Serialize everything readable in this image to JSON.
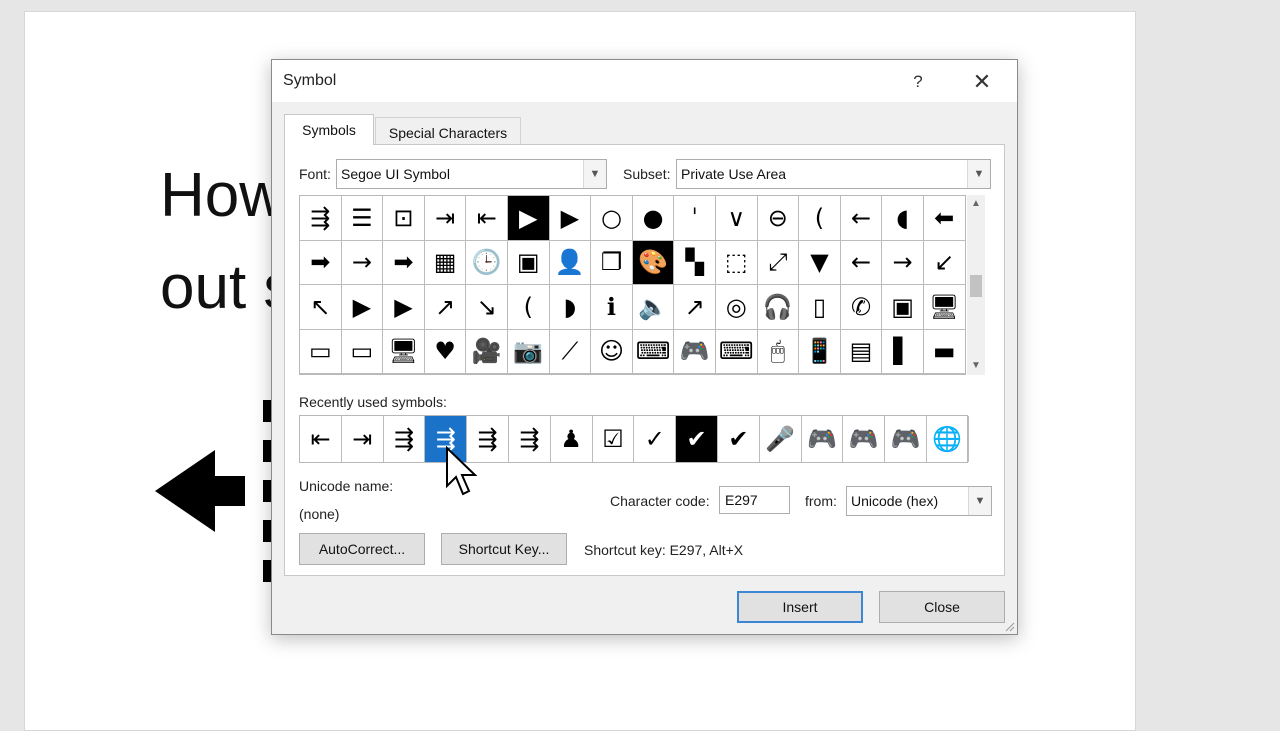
{
  "background_doc": {
    "line1": "How",
    "line2": "out s"
  },
  "dialog": {
    "title": "Symbol",
    "help_label": "?",
    "close_label": "✕",
    "tabs": [
      {
        "label": "Symbols",
        "active": true
      },
      {
        "label": "Special Characters",
        "active": false
      }
    ],
    "font_label": "Font:",
    "font_value": "Segoe UI Symbol",
    "subset_label": "Subset:",
    "subset_value": "Private Use Area",
    "symbol_grid": {
      "rows": [
        [
          "⇶",
          "☰",
          "⊡",
          "⇥",
          "⇤",
          "▶",
          "▶",
          "○",
          "●",
          "ˈ",
          "∨",
          "⊖",
          "(",
          "←",
          "◖",
          "⬅"
        ],
        [
          "➡",
          "→",
          "➡",
          "▦",
          "🕒",
          "▣",
          "👤",
          "❐",
          "🎨",
          "▚",
          "⬚",
          "⤢",
          "▼",
          "←",
          "→",
          "↙"
        ],
        [
          "↖",
          "▶",
          "▶",
          "↗",
          "↘",
          "(",
          "◗",
          "ℹ",
          "🔈",
          "↗",
          "◎",
          "🎧",
          "▯",
          "✆",
          "▣",
          "🖥"
        ],
        [
          "▭",
          "▭",
          "🖥",
          "♥",
          "🎥",
          "📷",
          "⟋",
          "☺",
          "⌨",
          "🎮",
          "⌨",
          "🖱",
          "📱",
          "▤",
          "▌",
          "▬"
        ]
      ],
      "inverted": [
        "0,5",
        "1,8"
      ]
    },
    "recent_label": "Recently used symbols:",
    "recent_symbols": [
      "⇤",
      "⇥",
      "⇶",
      "⇶",
      "⇶",
      "⇶",
      "♟",
      "☑",
      "✓",
      "✔",
      "✔",
      "🎤",
      "🎮",
      "🎮",
      "🎮",
      "🌐"
    ],
    "unicode_name_label": "Unicode name:",
    "unicode_name_value": "(none)",
    "character_code_label": "Character code:",
    "character_code_value": "E297",
    "from_label": "from:",
    "from_value": "Unicode (hex)",
    "autocorrect_label": "AutoCorrect...",
    "shortcut_key_button_label": "Shortcut Key...",
    "shortcut_key_text": "Shortcut key: E297, Alt+X",
    "insert_label": "Insert",
    "close_button_label": "Close"
  }
}
